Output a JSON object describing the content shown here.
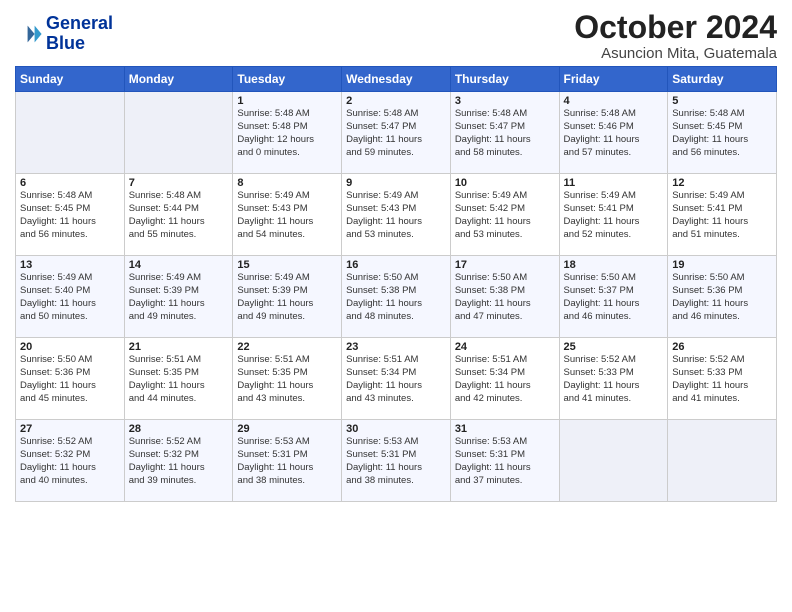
{
  "header": {
    "logo_line1": "General",
    "logo_line2": "Blue",
    "month": "October 2024",
    "location": "Asuncion Mita, Guatemala"
  },
  "days_of_week": [
    "Sunday",
    "Monday",
    "Tuesday",
    "Wednesday",
    "Thursday",
    "Friday",
    "Saturday"
  ],
  "weeks": [
    [
      {
        "day": "",
        "info": ""
      },
      {
        "day": "",
        "info": ""
      },
      {
        "day": "1",
        "info": "Sunrise: 5:48 AM\nSunset: 5:48 PM\nDaylight: 12 hours\nand 0 minutes."
      },
      {
        "day": "2",
        "info": "Sunrise: 5:48 AM\nSunset: 5:47 PM\nDaylight: 11 hours\nand 59 minutes."
      },
      {
        "day": "3",
        "info": "Sunrise: 5:48 AM\nSunset: 5:47 PM\nDaylight: 11 hours\nand 58 minutes."
      },
      {
        "day": "4",
        "info": "Sunrise: 5:48 AM\nSunset: 5:46 PM\nDaylight: 11 hours\nand 57 minutes."
      },
      {
        "day": "5",
        "info": "Sunrise: 5:48 AM\nSunset: 5:45 PM\nDaylight: 11 hours\nand 56 minutes."
      }
    ],
    [
      {
        "day": "6",
        "info": "Sunrise: 5:48 AM\nSunset: 5:45 PM\nDaylight: 11 hours\nand 56 minutes."
      },
      {
        "day": "7",
        "info": "Sunrise: 5:48 AM\nSunset: 5:44 PM\nDaylight: 11 hours\nand 55 minutes."
      },
      {
        "day": "8",
        "info": "Sunrise: 5:49 AM\nSunset: 5:43 PM\nDaylight: 11 hours\nand 54 minutes."
      },
      {
        "day": "9",
        "info": "Sunrise: 5:49 AM\nSunset: 5:43 PM\nDaylight: 11 hours\nand 53 minutes."
      },
      {
        "day": "10",
        "info": "Sunrise: 5:49 AM\nSunset: 5:42 PM\nDaylight: 11 hours\nand 53 minutes."
      },
      {
        "day": "11",
        "info": "Sunrise: 5:49 AM\nSunset: 5:41 PM\nDaylight: 11 hours\nand 52 minutes."
      },
      {
        "day": "12",
        "info": "Sunrise: 5:49 AM\nSunset: 5:41 PM\nDaylight: 11 hours\nand 51 minutes."
      }
    ],
    [
      {
        "day": "13",
        "info": "Sunrise: 5:49 AM\nSunset: 5:40 PM\nDaylight: 11 hours\nand 50 minutes."
      },
      {
        "day": "14",
        "info": "Sunrise: 5:49 AM\nSunset: 5:39 PM\nDaylight: 11 hours\nand 49 minutes."
      },
      {
        "day": "15",
        "info": "Sunrise: 5:49 AM\nSunset: 5:39 PM\nDaylight: 11 hours\nand 49 minutes."
      },
      {
        "day": "16",
        "info": "Sunrise: 5:50 AM\nSunset: 5:38 PM\nDaylight: 11 hours\nand 48 minutes."
      },
      {
        "day": "17",
        "info": "Sunrise: 5:50 AM\nSunset: 5:38 PM\nDaylight: 11 hours\nand 47 minutes."
      },
      {
        "day": "18",
        "info": "Sunrise: 5:50 AM\nSunset: 5:37 PM\nDaylight: 11 hours\nand 46 minutes."
      },
      {
        "day": "19",
        "info": "Sunrise: 5:50 AM\nSunset: 5:36 PM\nDaylight: 11 hours\nand 46 minutes."
      }
    ],
    [
      {
        "day": "20",
        "info": "Sunrise: 5:50 AM\nSunset: 5:36 PM\nDaylight: 11 hours\nand 45 minutes."
      },
      {
        "day": "21",
        "info": "Sunrise: 5:51 AM\nSunset: 5:35 PM\nDaylight: 11 hours\nand 44 minutes."
      },
      {
        "day": "22",
        "info": "Sunrise: 5:51 AM\nSunset: 5:35 PM\nDaylight: 11 hours\nand 43 minutes."
      },
      {
        "day": "23",
        "info": "Sunrise: 5:51 AM\nSunset: 5:34 PM\nDaylight: 11 hours\nand 43 minutes."
      },
      {
        "day": "24",
        "info": "Sunrise: 5:51 AM\nSunset: 5:34 PM\nDaylight: 11 hours\nand 42 minutes."
      },
      {
        "day": "25",
        "info": "Sunrise: 5:52 AM\nSunset: 5:33 PM\nDaylight: 11 hours\nand 41 minutes."
      },
      {
        "day": "26",
        "info": "Sunrise: 5:52 AM\nSunset: 5:33 PM\nDaylight: 11 hours\nand 41 minutes."
      }
    ],
    [
      {
        "day": "27",
        "info": "Sunrise: 5:52 AM\nSunset: 5:32 PM\nDaylight: 11 hours\nand 40 minutes."
      },
      {
        "day": "28",
        "info": "Sunrise: 5:52 AM\nSunset: 5:32 PM\nDaylight: 11 hours\nand 39 minutes."
      },
      {
        "day": "29",
        "info": "Sunrise: 5:53 AM\nSunset: 5:31 PM\nDaylight: 11 hours\nand 38 minutes."
      },
      {
        "day": "30",
        "info": "Sunrise: 5:53 AM\nSunset: 5:31 PM\nDaylight: 11 hours\nand 38 minutes."
      },
      {
        "day": "31",
        "info": "Sunrise: 5:53 AM\nSunset: 5:31 PM\nDaylight: 11 hours\nand 37 minutes."
      },
      {
        "day": "",
        "info": ""
      },
      {
        "day": "",
        "info": ""
      }
    ]
  ]
}
